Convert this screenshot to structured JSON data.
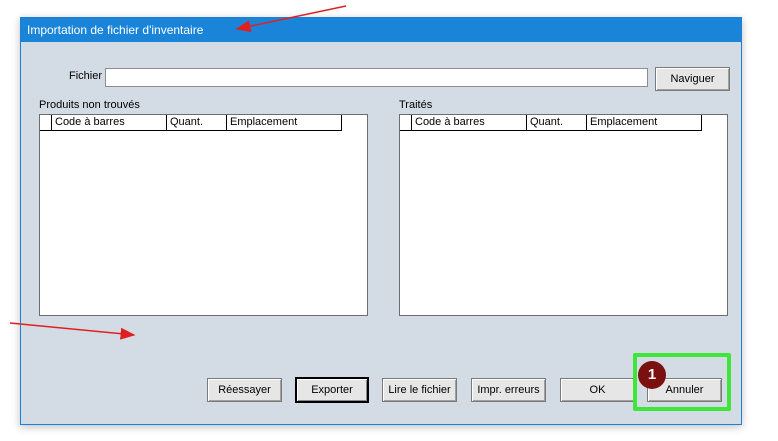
{
  "window": {
    "title": "Importation de fichier d'inventaire"
  },
  "file": {
    "label": "Fichier",
    "value": "",
    "browse_label": "Naviguer"
  },
  "panels": [
    {
      "title": "Produits non trouvés",
      "columns": [
        "Code à barres",
        "Quant.",
        "Emplacement"
      ],
      "rows": []
    },
    {
      "title": "Traités",
      "columns": [
        "Code à barres",
        "Quant.",
        "Emplacement"
      ],
      "rows": []
    }
  ],
  "buttons": {
    "retry": "Réessayer",
    "export": "Exporter",
    "read_file": "Lire le fichier",
    "print_errors": "Impr. erreurs",
    "ok": "OK",
    "cancel": "Annuler"
  },
  "annotation": {
    "badge_number": "1",
    "highlight_color": "#3ee63a",
    "badge_color": "#7a1010",
    "arrow_color": "#e02020"
  },
  "colors": {
    "titlebar": "#1a84d9",
    "dialog_bg": "#d3dbe5"
  }
}
